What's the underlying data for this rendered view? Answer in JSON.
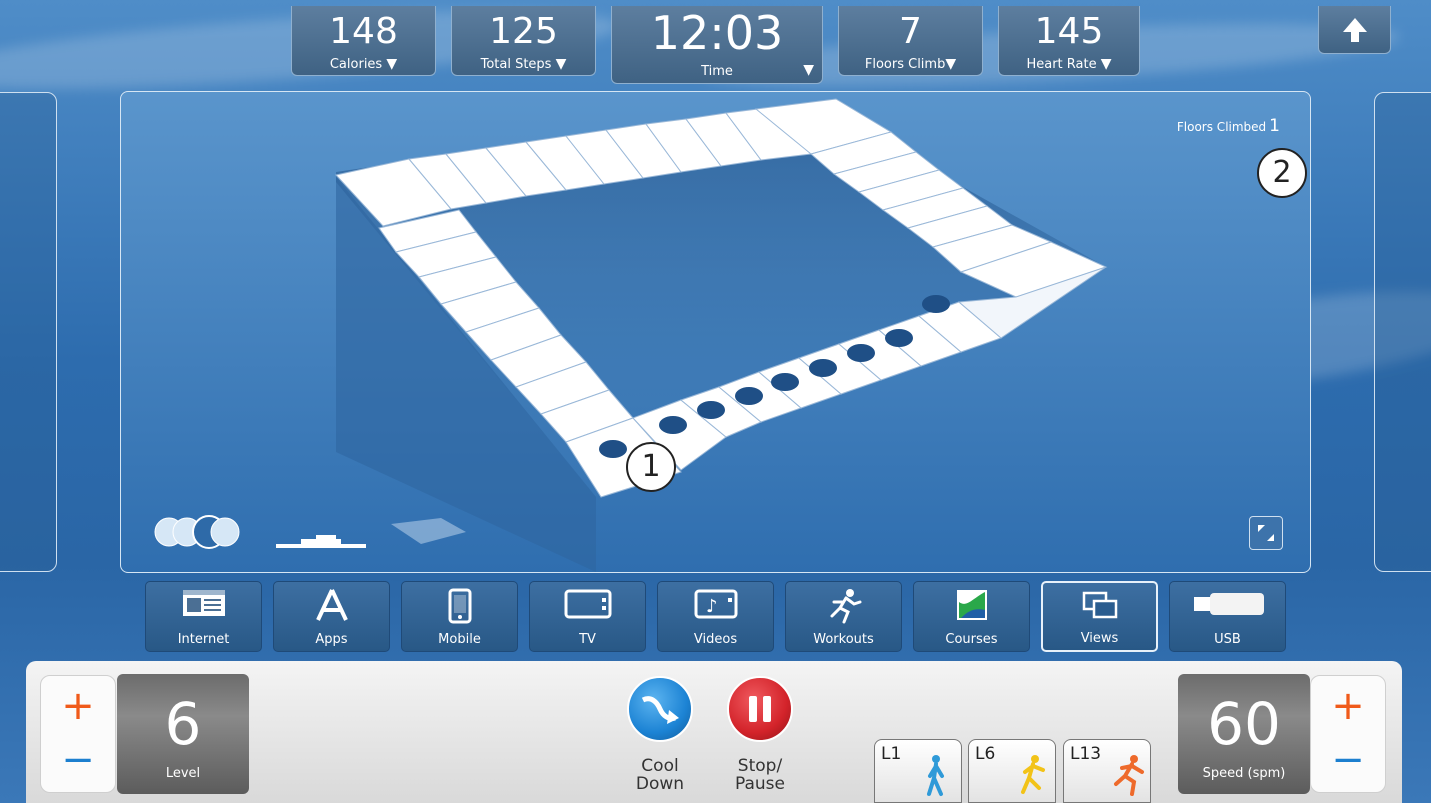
{
  "stats": [
    {
      "value": "148",
      "label": "Calories"
    },
    {
      "value": "125",
      "label": "Total Steps"
    },
    {
      "value": "12:03",
      "label": "Time"
    },
    {
      "value": "7",
      "label": "Floors Climb"
    },
    {
      "value": "145",
      "label": "Heart Rate"
    }
  ],
  "main": {
    "floors_label": "Floors Climbed",
    "floors_value": "1",
    "callout1": "1",
    "callout2": "2"
  },
  "nav": [
    {
      "label": "Internet",
      "icon": "internet-icon"
    },
    {
      "label": "Apps",
      "icon": "apps-icon"
    },
    {
      "label": "Mobile",
      "icon": "mobile-icon"
    },
    {
      "label": "TV",
      "icon": "tv-icon"
    },
    {
      "label": "Videos",
      "icon": "videos-icon"
    },
    {
      "label": "Workouts",
      "icon": "workouts-icon"
    },
    {
      "label": "Courses",
      "icon": "courses-icon"
    },
    {
      "label": "Views",
      "icon": "views-icon",
      "active": true
    },
    {
      "label": "USB",
      "icon": "usb-icon"
    }
  ],
  "console": {
    "level_value": "6",
    "level_label": "Level",
    "speed_value": "60",
    "speed_label": "Speed (spm)",
    "plus": "+",
    "minus": "−",
    "cool_down_line1": "Cool",
    "cool_down_line2": "Down",
    "stop_pause_line1": "Stop/",
    "stop_pause_line2": "Pause",
    "presets": [
      {
        "label": "L1",
        "color": "#2f9ad8"
      },
      {
        "label": "L6",
        "color": "#f2c318"
      },
      {
        "label": "L13",
        "color": "#ee6a2b"
      }
    ]
  },
  "colors": {
    "plus": "#f05a1a",
    "minus": "#1c7fcf",
    "cool_down": "#1c83d4",
    "stop": "#d3232a"
  }
}
